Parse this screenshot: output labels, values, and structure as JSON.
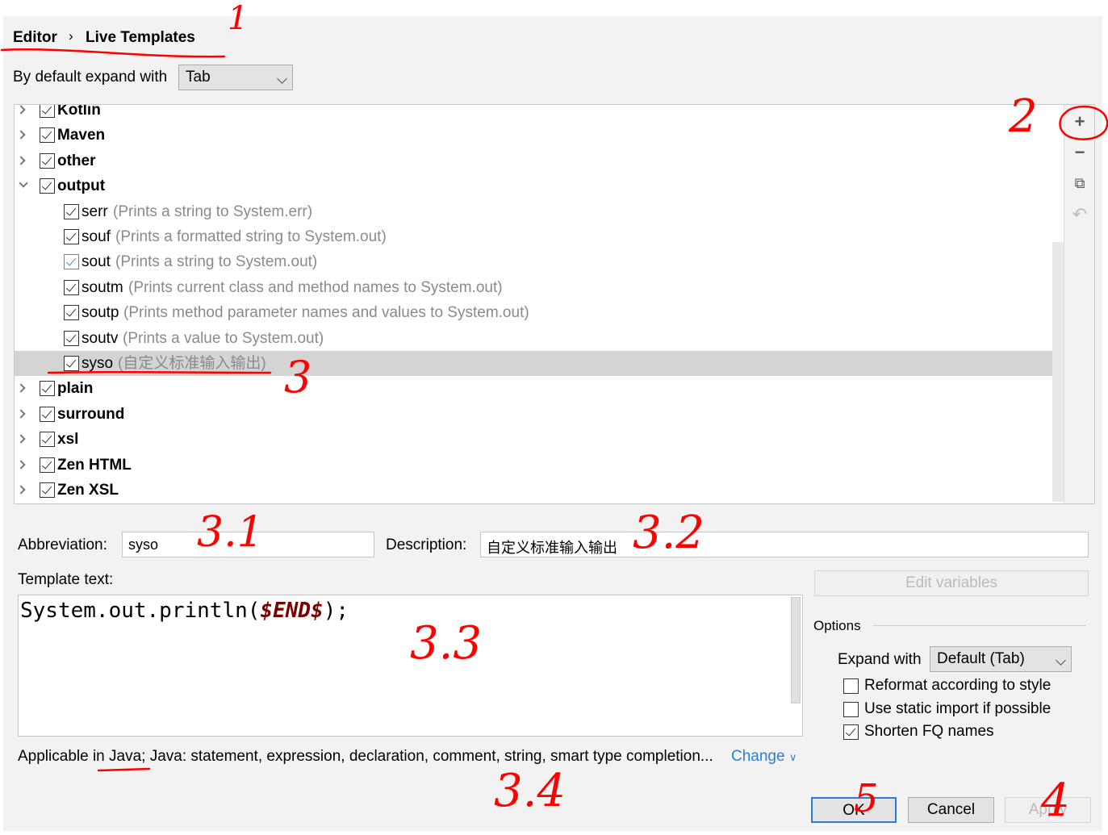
{
  "breadcrumb": {
    "parent": "Editor",
    "separator": "›",
    "current": "Live Templates"
  },
  "expand": {
    "label": "By default expand with",
    "value": "Tab"
  },
  "tree": [
    {
      "label": "Kotlin",
      "group": true,
      "expanded": false,
      "checked": true
    },
    {
      "label": "Maven",
      "group": true,
      "expanded": false,
      "checked": true
    },
    {
      "label": "other",
      "group": true,
      "expanded": false,
      "checked": true
    },
    {
      "label": "output",
      "group": true,
      "expanded": true,
      "checked": true
    },
    {
      "label": "serr",
      "desc": "(Prints a string to System.err)",
      "checked": true
    },
    {
      "label": "souf",
      "desc": "(Prints a formatted string to System.out)",
      "checked": true
    },
    {
      "label": "sout",
      "desc": "(Prints a string to System.out)",
      "checked": true,
      "focused": true
    },
    {
      "label": "soutm",
      "desc": "(Prints current class and method names to System.out)",
      "checked": true
    },
    {
      "label": "soutp",
      "desc": "(Prints method parameter names and values to System.out)",
      "checked": true
    },
    {
      "label": "soutv",
      "desc": "(Prints a value to System.out)",
      "checked": true
    },
    {
      "label": "syso",
      "desc": "(自定义标准输入输出)",
      "checked": true,
      "selected": true
    },
    {
      "label": "plain",
      "group": true,
      "expanded": false,
      "checked": true
    },
    {
      "label": "surround",
      "group": true,
      "expanded": false,
      "checked": true
    },
    {
      "label": "xsl",
      "group": true,
      "expanded": false,
      "checked": true
    },
    {
      "label": "Zen HTML",
      "group": true,
      "expanded": false,
      "checked": true
    },
    {
      "label": "Zen XSL",
      "group": true,
      "expanded": false,
      "checked": true
    }
  ],
  "toolbar": {
    "add": "plus-icon",
    "remove": "minus-icon",
    "copy": "copy-icon",
    "restore": "undo-icon"
  },
  "editor": {
    "abbreviation_label": "Abbreviation:",
    "abbreviation": "syso",
    "description_label": "Description:",
    "description": "自定义标准输入输出",
    "template_label": "Template text:",
    "template_prefix": "System.out.println(",
    "template_var": "$END$",
    "template_suffix": ");",
    "edit_variables": "Edit variables",
    "applicable": "Applicable in Java; Java: statement, expression, declaration, comment, string, smart type completion...",
    "change": "Change"
  },
  "options": {
    "title": "Options",
    "expand_label": "Expand with",
    "expand_value": "Default (Tab)",
    "checkboxes": [
      {
        "label": "Reformat according to style",
        "checked": false
      },
      {
        "label": "Use static import if possible",
        "checked": false
      },
      {
        "label": "Shorten FQ names",
        "checked": true
      }
    ]
  },
  "buttons": {
    "ok": "OK",
    "cancel": "Cancel",
    "apply": "Apply"
  },
  "annotations": {
    "a1": "1",
    "a2": "2",
    "a3": "3",
    "a31": "3.1",
    "a32": "3.2",
    "a33": "3.3",
    "a34": "3.4",
    "a4": "4",
    "a5": "5"
  },
  "colors": {
    "annotation": "#ff0000",
    "link": "#2a7fd4",
    "variable": "#7a0000",
    "selection": "#d4d4d4"
  }
}
